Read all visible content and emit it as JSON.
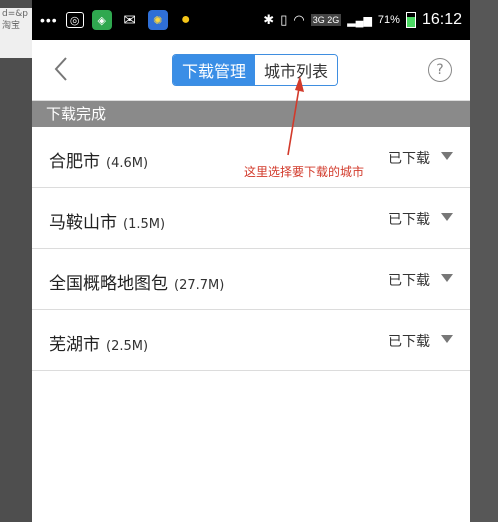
{
  "browser_fragment": {
    "line1": "d=&p",
    "line2": "淘宝"
  },
  "statusbar": {
    "dots": "•••",
    "battery": "71%",
    "time": "16:12",
    "network": "3G 2G"
  },
  "navbar": {
    "back_icon": "chevron-left-icon",
    "tabs": [
      {
        "label": "下载管理",
        "active": true
      },
      {
        "label": "城市列表",
        "active": false
      }
    ],
    "help_label": "?"
  },
  "section": {
    "title": "下载完成"
  },
  "downloads": [
    {
      "name": "合肥市",
      "size": "(4.6M)",
      "status": "已下载"
    },
    {
      "name": "马鞍山市",
      "size": "(1.5M)",
      "status": "已下载"
    },
    {
      "name": "全国概略地图包",
      "size": "(27.7M)",
      "status": "已下载"
    },
    {
      "name": "芜湖市",
      "size": "(2.5M)",
      "status": "已下载"
    }
  ],
  "annotation": {
    "text": "这里选择要下载的城市",
    "color": "#d23a2b"
  },
  "colors": {
    "accent": "#3a8ee6",
    "section_bg": "#8a8a8a"
  }
}
